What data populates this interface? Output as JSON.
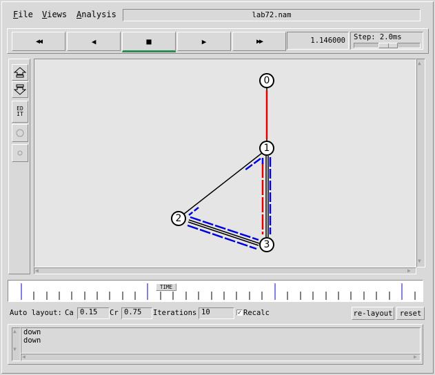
{
  "menu": {
    "file": "File",
    "views": "Views",
    "analysis": "Analysis"
  },
  "window_title": "lab72.nam",
  "playback": {
    "rewind_icon": "◀◀",
    "back_icon": "◀",
    "stop_icon": "■",
    "play_icon": "▶",
    "forward_icon": "▶▶",
    "time": "1.146000",
    "step_label": "Step: 2.0ms"
  },
  "tools": {
    "zoom_in": "zoom-in-icon",
    "zoom_out": "zoom-out-icon",
    "edit_label_1": "ED",
    "edit_label_2": "IT"
  },
  "network": {
    "nodes": [
      {
        "id": "0"
      },
      {
        "id": "1"
      },
      {
        "id": "2"
      },
      {
        "id": "3"
      }
    ],
    "colors": {
      "red": "#e00000",
      "blue": "#0000e0",
      "link": "#000000"
    }
  },
  "timeline": {
    "marker_label": "TIME"
  },
  "layout": {
    "auto_layout_label": "Auto layout:",
    "ca_label": "Ca",
    "ca_value": "0.15",
    "cr_label": "Cr",
    "cr_value": "0.75",
    "iterations_label": "Iterations",
    "iterations_value": "10",
    "recalc_label": "Recalc",
    "recalc_checked": true,
    "relayout_button": "re-layout",
    "reset_button": "reset"
  },
  "log": {
    "lines": [
      "down",
      "down"
    ]
  }
}
